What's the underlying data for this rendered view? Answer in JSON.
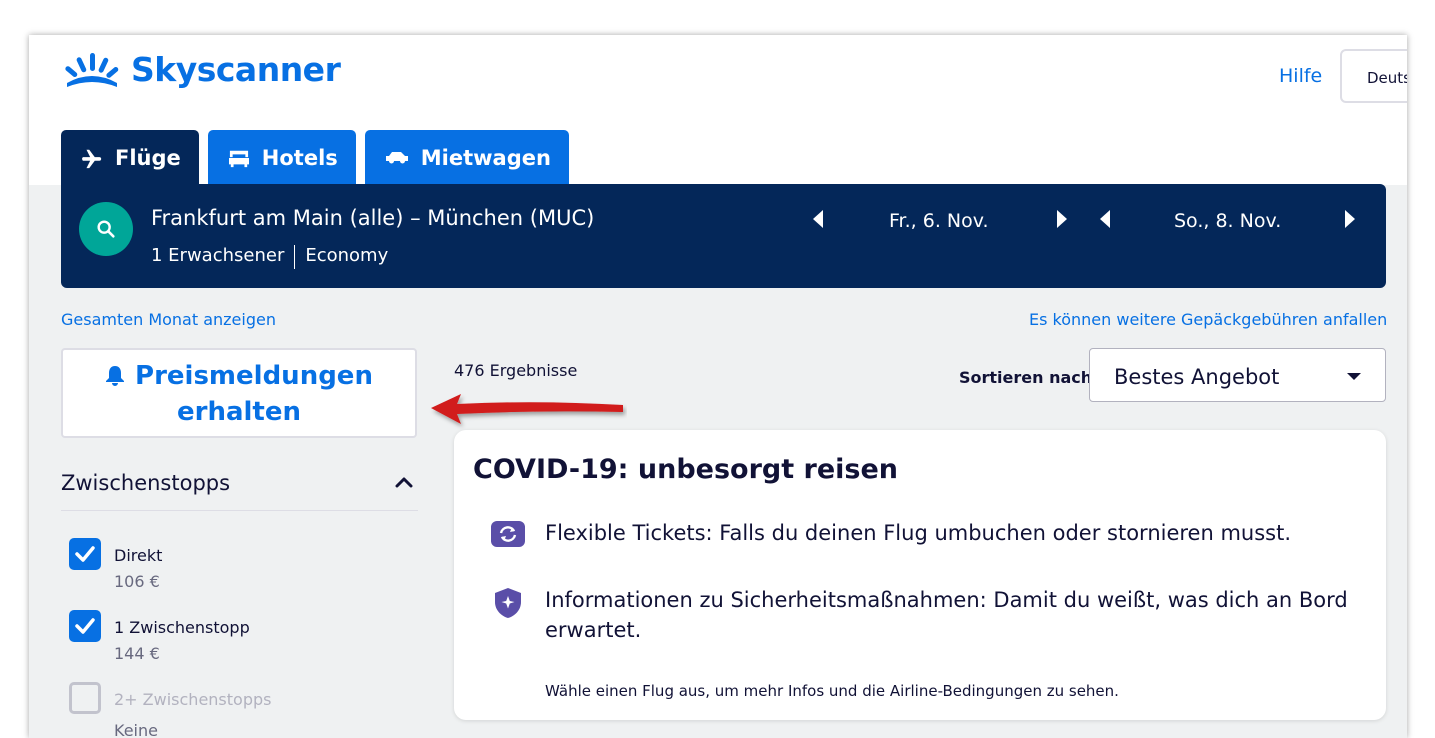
{
  "app": {
    "logo_text": "Skyscanner",
    "help_label": "Hilfe",
    "language_label": "Deuts"
  },
  "tabs": [
    {
      "label": "Flüge",
      "icon": "plane-icon",
      "active": true
    },
    {
      "label": "Hotels",
      "icon": "bed-icon",
      "active": false
    },
    {
      "label": "Mietwagen",
      "icon": "car-icon",
      "active": false
    }
  ],
  "search": {
    "route": "Frankfurt am Main (alle) – München (MUC)",
    "passengers": "1 Erwachsener",
    "cabin_class": "Economy",
    "depart_date": "Fr., 6. Nov.",
    "return_date": "So., 8. Nov."
  },
  "links": {
    "whole_month": "Gesamten Monat anzeigen",
    "baggage_fees": "Es können weitere Gepäckgebühren anfallen"
  },
  "price_alert": {
    "line1": "Preismeldungen",
    "line2": "erhalten"
  },
  "results": {
    "count_text": "476 Ergebnisse",
    "sort_label": "Sortieren nach",
    "sort_value": "Bestes Angebot"
  },
  "filters": {
    "stops_title": "Zwischenstopps",
    "options": [
      {
        "label": "Direkt",
        "price": "106 €",
        "checked": true
      },
      {
        "label": "1 Zwischenstopp",
        "price": "144 €",
        "checked": true
      },
      {
        "label": "2+ Zwischenstopps",
        "price": "Keine",
        "checked": false
      }
    ]
  },
  "covid": {
    "title": "COVID-19: unbesorgt reisen",
    "item1": "Flexible Tickets: Falls du deinen Flug umbuchen oder stornieren musst.",
    "item2_line1": "Informationen zu Sicherheitsmaßnahmen: Damit du weißt, was dich an Bord",
    "item2_line2": "erwartet.",
    "note": "Wähle einen Flug aus, um mehr Infos und die Airline-Bedingungen zu sehen."
  },
  "colors": {
    "brand_blue": "#0770e3",
    "navy": "#042759",
    "teal": "#00a698",
    "covid_purple": "#5a4ea8",
    "annotation_red": "#d11a1a"
  }
}
